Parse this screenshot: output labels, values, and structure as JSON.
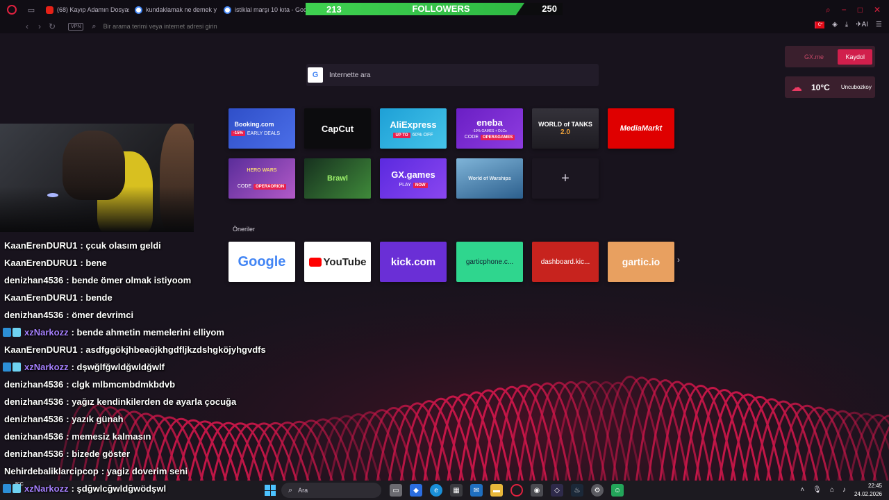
{
  "browser": {
    "tabs": [
      {
        "label": "(68) Kayıp Adamın Dosyas",
        "favicon": "youtube"
      },
      {
        "label": "kundaklamak ne demek y",
        "favicon": "google"
      },
      {
        "label": "istiklal marşı 10 kıta - Goo",
        "favicon": "google"
      }
    ],
    "address_placeholder": "Bir arama terimi veya internet adresi girin",
    "vpn_label": "VPN",
    "ai_label": "AI",
    "flag_label": "C*"
  },
  "followers_widget": {
    "current": "213",
    "label": "FOLLOWERS",
    "goal": "250",
    "progress_fraction": 0.852,
    "color": "#3fd150"
  },
  "search": {
    "placeholder": "İnternette ara",
    "engine_letter": "G"
  },
  "gx": {
    "gxme_label": "GX.me",
    "register_label": "Kaydol",
    "weather_temp": "10°C",
    "weather_city": "Uncubozkoy"
  },
  "speed_dials": [
    {
      "name": "Booking.com",
      "tag": "-15%",
      "sub": "EARLY DEALS",
      "color": "#3a5bd1"
    },
    {
      "name": "CapCut",
      "color": "#0c0c0e"
    },
    {
      "name": "AliExpress",
      "tag": "UP TO",
      "sub": "60% OFF",
      "color": "#2aa7dc"
    },
    {
      "name": "eneba",
      "sub": "CODE",
      "tag": "OPERAGAMES",
      "extra": "-10% GAMES + DLCs",
      "color": "#7a28c9"
    },
    {
      "name": "WORLD of TANKS",
      "sub": "2.0",
      "color": "#26242a"
    },
    {
      "name": "MediaMarkt",
      "color": "#df0000"
    },
    {
      "name": "HERO WARS",
      "sub": "CODE",
      "tag": "OPERAORION",
      "color": "#7b3fb8"
    },
    {
      "name": "Brawl",
      "color": "#1f4d2a"
    },
    {
      "name": "GX.games",
      "sub": "PLAY",
      "tag": "NOW",
      "color": "#6b2fe0"
    },
    {
      "name": "World of Warships",
      "color": "#2e6fa8"
    }
  ],
  "add_dial_label": "+",
  "suggestions_label": "Öneriler",
  "suggestions": [
    {
      "name": "Google",
      "color": "#ffffff"
    },
    {
      "name": "YouTube",
      "color": "#ffffff"
    },
    {
      "name": "kick.com",
      "color": "#6a2fd6"
    },
    {
      "name": "garticphone.c...",
      "color": "#2fd68e"
    },
    {
      "name": "dashboard.kic...",
      "color": "#c7231e"
    },
    {
      "name": "gartic.io",
      "color": "#e8a060"
    }
  ],
  "chat": [
    {
      "user": "KaanErenDURU1",
      "text": ": çcuk olasım geldi",
      "badge": false,
      "purple": false
    },
    {
      "user": "KaanErenDURU1",
      "text": ": bene",
      "badge": false,
      "purple": false
    },
    {
      "user": "denizhan4536",
      "text": ": bende ömer olmak istiyoom",
      "badge": false,
      "purple": false
    },
    {
      "user": "KaanErenDURU1",
      "text": ": bende",
      "badge": false,
      "purple": false
    },
    {
      "user": "denizhan4536",
      "text": ": ömer devrimci",
      "badge": false,
      "purple": false
    },
    {
      "user": "xzNarkozz",
      "text": ": bende ahmetin memelerini elliyom",
      "badge": true,
      "purple": true
    },
    {
      "user": "KaanErenDURU1",
      "text": ": asdfggökjhbeaöjkhgdfljkzdshgköjyhgvdfs",
      "badge": false,
      "purple": false
    },
    {
      "user": "xzNarkozz",
      "text": ": dşwğlfğwldğwldğwlf",
      "badge": true,
      "purple": true
    },
    {
      "user": "denizhan4536",
      "text": ": clgk mlbmcmbdmkbdvb",
      "badge": false,
      "purple": false
    },
    {
      "user": "denizhan4536",
      "text": ": yağız kendinkilerden de ayarla çocuğa",
      "badge": false,
      "purple": false
    },
    {
      "user": "denizhan4536",
      "text": ": yazık günah",
      "badge": false,
      "purple": false
    },
    {
      "user": "denizhan4536",
      "text": ": memesiz kalmasın",
      "badge": false,
      "purple": false
    },
    {
      "user": "denizhan4536",
      "text": ": bizede göster",
      "badge": false,
      "purple": false
    },
    {
      "user": "Nehirdebaliklarcipcop",
      "text": ": yagiz doverim seni",
      "badge": false,
      "purple": false
    },
    {
      "user": "xzNarkozz",
      "text": ": şdğwlcğwldğwödşwl",
      "badge": true,
      "purple": true
    }
  ],
  "taskbar": {
    "weather_temp": "9°C",
    "search_placeholder": "Ara",
    "time": "22:45",
    "date": "24.02.2026"
  }
}
